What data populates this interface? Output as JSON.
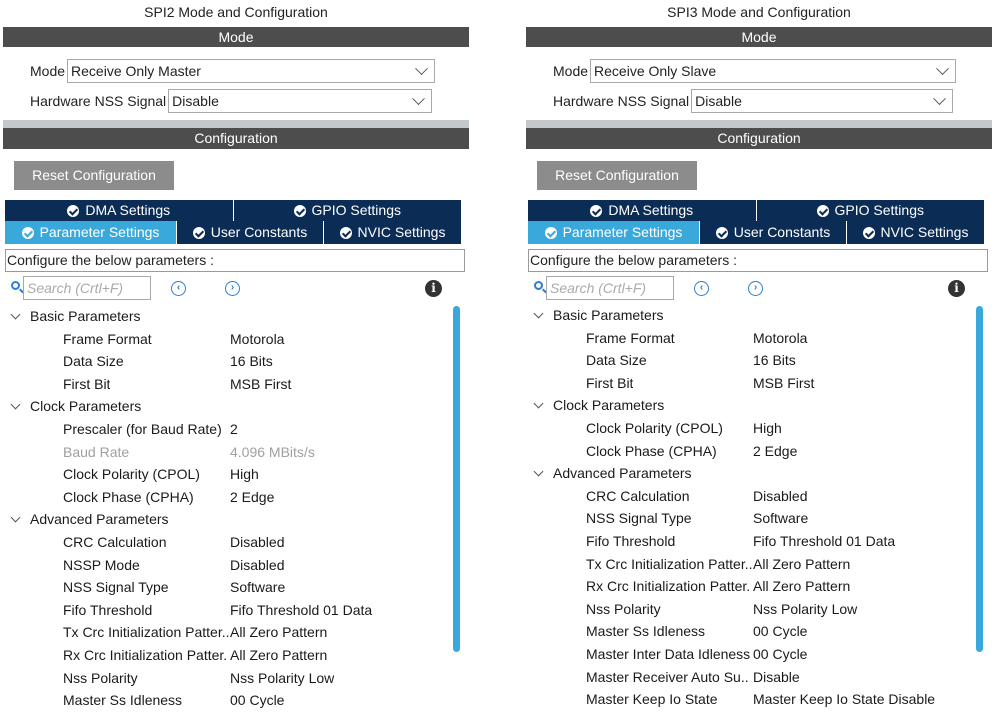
{
  "left": {
    "title": "SPI2 Mode and Configuration",
    "mode_bar": "Mode",
    "mode": {
      "label": "Mode",
      "value": "Receive Only Master"
    },
    "nss": {
      "label": "Hardware NSS Signal",
      "value": "Disable"
    },
    "config_bar": "Configuration",
    "reset_label": "Reset Configuration",
    "tabs_top": [
      "DMA Settings",
      "GPIO Settings"
    ],
    "tabs_bottom": [
      "Parameter Settings",
      "User Constants",
      "NVIC Settings"
    ],
    "configure_text": "Configure the below parameters :",
    "search_placeholder": "Search (Crtl+F)",
    "groups": [
      {
        "name": "Basic Parameters",
        "params": [
          {
            "name": "Frame Format",
            "value": "Motorola"
          },
          {
            "name": "Data Size",
            "value": "16 Bits"
          },
          {
            "name": "First Bit",
            "value": "MSB First"
          }
        ]
      },
      {
        "name": "Clock Parameters",
        "params": [
          {
            "name": "Prescaler (for Baud Rate)",
            "value": "2"
          },
          {
            "name": "Baud Rate",
            "value": "4.096 MBits/s",
            "disabled": true
          },
          {
            "name": "Clock Polarity (CPOL)",
            "value": "High"
          },
          {
            "name": "Clock Phase (CPHA)",
            "value": "2 Edge"
          }
        ]
      },
      {
        "name": "Advanced Parameters",
        "params": [
          {
            "name": "CRC Calculation",
            "value": "Disabled"
          },
          {
            "name": "NSSP Mode",
            "value": "Disabled"
          },
          {
            "name": "NSS Signal Type",
            "value": "Software"
          },
          {
            "name": "Fifo Threshold",
            "value": "Fifo Threshold 01 Data"
          },
          {
            "name": "Tx Crc Initialization Patter..",
            "value": "All Zero Pattern"
          },
          {
            "name": "Rx Crc Initialization Patter.",
            "value": "All Zero Pattern"
          },
          {
            "name": "Nss Polarity",
            "value": "Nss Polarity Low"
          },
          {
            "name": "Master Ss Idleness",
            "value": "00 Cycle"
          }
        ]
      }
    ]
  },
  "right": {
    "title": "SPI3 Mode and Configuration",
    "mode_bar": "Mode",
    "mode": {
      "label": "Mode",
      "value": "Receive Only Slave"
    },
    "nss": {
      "label": "Hardware NSS Signal",
      "value": "Disable"
    },
    "config_bar": "Configuration",
    "reset_label": "Reset Configuration",
    "tabs_top": [
      "DMA Settings",
      "GPIO Settings"
    ],
    "tabs_bottom": [
      "Parameter Settings",
      "User Constants",
      "NVIC Settings"
    ],
    "configure_text": "Configure the below parameters :",
    "search_placeholder": "Search (Crtl+F)",
    "groups": [
      {
        "name": "Basic Parameters",
        "params": [
          {
            "name": "Frame Format",
            "value": "Motorola"
          },
          {
            "name": "Data Size",
            "value": "16 Bits"
          },
          {
            "name": "First Bit",
            "value": "MSB First"
          }
        ]
      },
      {
        "name": "Clock Parameters",
        "params": [
          {
            "name": "Clock Polarity (CPOL)",
            "value": "High"
          },
          {
            "name": "Clock Phase (CPHA)",
            "value": "2 Edge"
          }
        ]
      },
      {
        "name": "Advanced Parameters",
        "params": [
          {
            "name": "CRC Calculation",
            "value": "Disabled"
          },
          {
            "name": "NSS Signal Type",
            "value": "Software"
          },
          {
            "name": "Fifo Threshold",
            "value": "Fifo Threshold 01 Data"
          },
          {
            "name": "Tx Crc Initialization Patter..",
            "value": "All Zero Pattern"
          },
          {
            "name": "Rx Crc Initialization Patter.",
            "value": "All Zero Pattern"
          },
          {
            "name": "Nss Polarity",
            "value": "Nss Polarity Low"
          },
          {
            "name": "Master Ss Idleness",
            "value": "00 Cycle"
          },
          {
            "name": "Master Inter Data Idleness",
            "value": "00 Cycle"
          },
          {
            "name": "Master Receiver Auto Su..",
            "value": "Disable"
          },
          {
            "name": "Master Keep Io State",
            "value": "Master Keep Io State Disable"
          }
        ]
      }
    ]
  },
  "icons": {
    "check": "check-circle-icon",
    "search": "search-icon",
    "prev": "prev-icon",
    "next": "next-icon",
    "info": "info-icon",
    "expand": "chevron-down-icon"
  },
  "colors": {
    "tab_dark": "#0b2c55",
    "tab_active": "#39a9dc",
    "bar": "#4d4d4d",
    "reset": "#8c8c8c"
  }
}
